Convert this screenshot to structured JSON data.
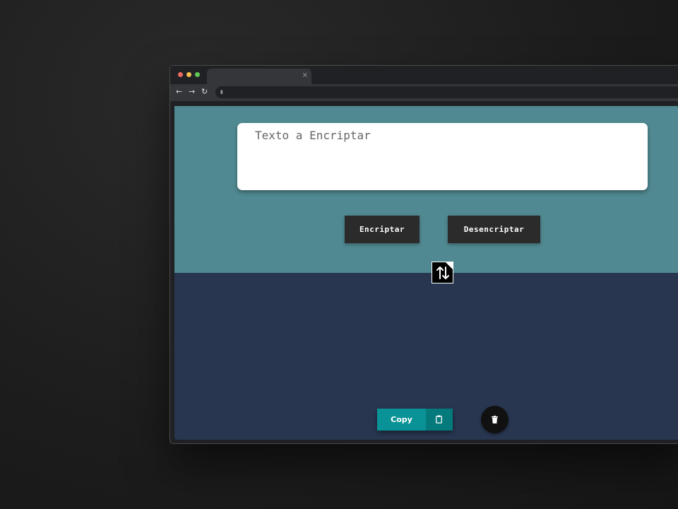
{
  "browser": {
    "tab_close": "×",
    "nav": {
      "back": "←",
      "forward": "→",
      "reload": "↻"
    }
  },
  "input": {
    "placeholder": "Texto a Encriptar",
    "value": ""
  },
  "buttons": {
    "encrypt_label": "Encriptar",
    "decrypt_label": "Desencriptar",
    "copy_label": "Copy"
  },
  "icons": {
    "swap": "swap-vertical-icon",
    "clipboard": "clipboard-icon",
    "trash": "trash-icon",
    "lock": "lock-icon",
    "share": "share-icon"
  },
  "colors": {
    "top_panel": "#508991",
    "bottom_panel": "#283650",
    "button_dark": "#2b2b2b",
    "copy_button": "#0a9396",
    "trash_button": "#111111"
  }
}
